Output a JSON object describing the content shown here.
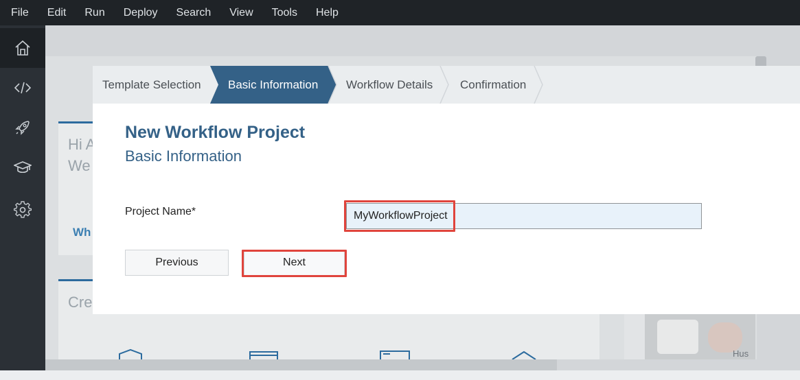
{
  "menu": [
    "File",
    "Edit",
    "Run",
    "Deploy",
    "Search",
    "View",
    "Tools",
    "Help"
  ],
  "sidebar": {
    "items": [
      {
        "icon": "home-icon",
        "active": true
      },
      {
        "icon": "code-icon",
        "active": false
      },
      {
        "icon": "rocket-icon",
        "active": false
      },
      {
        "icon": "graduation-cap-icon",
        "active": false
      },
      {
        "icon": "gear-icon",
        "active": false
      }
    ]
  },
  "background": {
    "greeting_line1": "Hi A",
    "greeting_line2": "We",
    "link_text": "Wh",
    "create_text": "Cre",
    "photo_caption": "Hus"
  },
  "wizard": {
    "steps": [
      {
        "label": "Template Selection",
        "active": false
      },
      {
        "label": "Basic Information",
        "active": true
      },
      {
        "label": "Workflow Details",
        "active": false
      },
      {
        "label": "Confirmation",
        "active": false
      }
    ],
    "title": "New Workflow Project",
    "subtitle": "Basic Information",
    "project_name_label": "Project Name*",
    "project_name_value": "MyWorkflowProject",
    "previous_label": "Previous",
    "next_label": "Next"
  },
  "colors": {
    "active_step": "#346187",
    "title": "#346187",
    "highlight": "#e0443c"
  }
}
